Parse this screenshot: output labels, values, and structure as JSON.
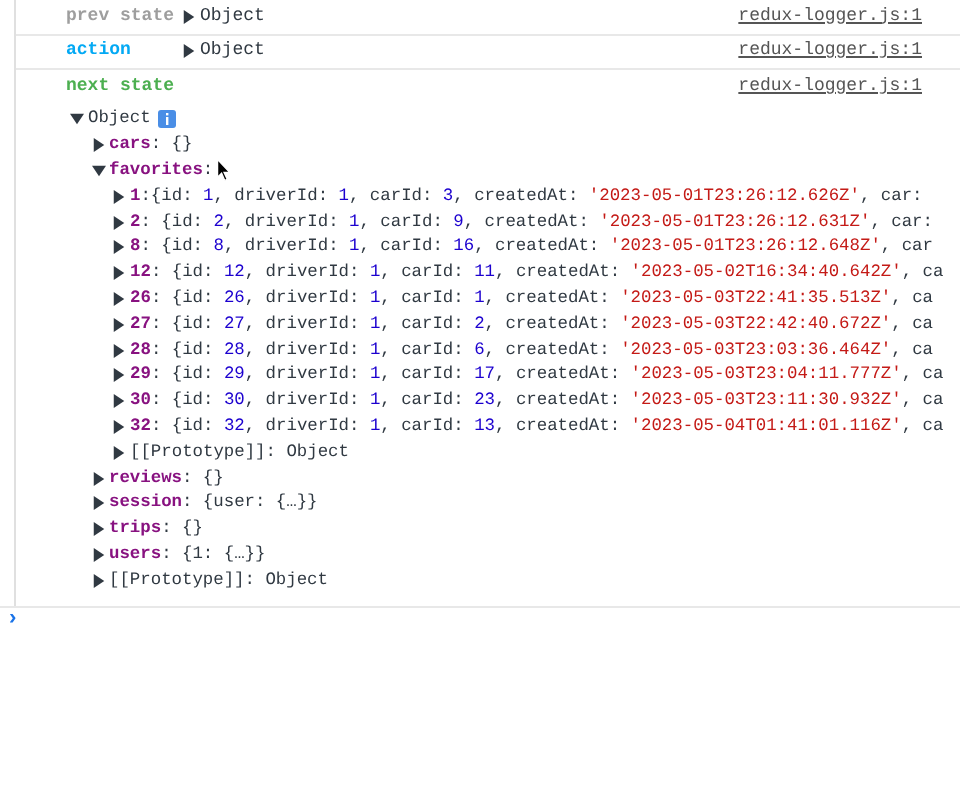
{
  "log": [
    {
      "label": "prev state",
      "kind": "prev",
      "value": "Object",
      "source": "redux-logger.js:1"
    },
    {
      "label": "action",
      "kind": "action",
      "value": "Object",
      "source": "redux-logger.js:1"
    },
    {
      "label": "next state",
      "kind": "next",
      "source": "redux-logger.js:1"
    }
  ],
  "tree": {
    "key": "Object",
    "info_badge": true,
    "expanded": true,
    "children": [
      {
        "key": "cars",
        "kind": "prop",
        "expanded": false,
        "preview": [
          {
            "text": ": {}",
            "kind": "plain"
          }
        ]
      },
      {
        "key": "favorites",
        "kind": "prop",
        "expanded": true,
        "preview": [
          {
            "text": ":",
            "kind": "plain"
          }
        ],
        "children": [
          {
            "key": "1",
            "kind": "prop",
            "expanded": false,
            "preview": [
              {
                "text": ":{id: ",
                "kind": "plain"
              },
              {
                "text": "1",
                "kind": "number"
              },
              {
                "text": ", driverId: ",
                "kind": "plain"
              },
              {
                "text": "1",
                "kind": "number"
              },
              {
                "text": ", carId: ",
                "kind": "plain"
              },
              {
                "text": "3",
                "kind": "number"
              },
              {
                "text": ", createdAt: ",
                "kind": "plain"
              },
              {
                "text": "'2023-05-01T23:26:12.626Z'",
                "kind": "string"
              },
              {
                "text": ", car:",
                "kind": "plain"
              }
            ]
          },
          {
            "key": "2",
            "kind": "prop",
            "expanded": false,
            "preview": [
              {
                "text": ": {id: ",
                "kind": "plain"
              },
              {
                "text": "2",
                "kind": "number"
              },
              {
                "text": ", driverId: ",
                "kind": "plain"
              },
              {
                "text": "1",
                "kind": "number"
              },
              {
                "text": ", carId: ",
                "kind": "plain"
              },
              {
                "text": "9",
                "kind": "number"
              },
              {
                "text": ", createdAt: ",
                "kind": "plain"
              },
              {
                "text": "'2023-05-01T23:26:12.631Z'",
                "kind": "string"
              },
              {
                "text": ", car:",
                "kind": "plain"
              }
            ]
          },
          {
            "key": "8",
            "kind": "prop",
            "expanded": false,
            "preview": [
              {
                "text": ": {id: ",
                "kind": "plain"
              },
              {
                "text": "8",
                "kind": "number"
              },
              {
                "text": ", driverId: ",
                "kind": "plain"
              },
              {
                "text": "1",
                "kind": "number"
              },
              {
                "text": ", carId: ",
                "kind": "plain"
              },
              {
                "text": "16",
                "kind": "number"
              },
              {
                "text": ", createdAt: ",
                "kind": "plain"
              },
              {
                "text": "'2023-05-01T23:26:12.648Z'",
                "kind": "string"
              },
              {
                "text": ", car",
                "kind": "plain"
              }
            ]
          },
          {
            "key": "12",
            "kind": "prop",
            "expanded": false,
            "preview": [
              {
                "text": ": {id: ",
                "kind": "plain"
              },
              {
                "text": "12",
                "kind": "number"
              },
              {
                "text": ", driverId: ",
                "kind": "plain"
              },
              {
                "text": "1",
                "kind": "number"
              },
              {
                "text": ", carId: ",
                "kind": "plain"
              },
              {
                "text": "11",
                "kind": "number"
              },
              {
                "text": ", createdAt: ",
                "kind": "plain"
              },
              {
                "text": "'2023-05-02T16:34:40.642Z'",
                "kind": "string"
              },
              {
                "text": ", ca",
                "kind": "plain"
              }
            ]
          },
          {
            "key": "26",
            "kind": "prop",
            "expanded": false,
            "preview": [
              {
                "text": ": {id: ",
                "kind": "plain"
              },
              {
                "text": "26",
                "kind": "number"
              },
              {
                "text": ", driverId: ",
                "kind": "plain"
              },
              {
                "text": "1",
                "kind": "number"
              },
              {
                "text": ", carId: ",
                "kind": "plain"
              },
              {
                "text": "1",
                "kind": "number"
              },
              {
                "text": ", createdAt: ",
                "kind": "plain"
              },
              {
                "text": "'2023-05-03T22:41:35.513Z'",
                "kind": "string"
              },
              {
                "text": ", ca",
                "kind": "plain"
              }
            ]
          },
          {
            "key": "27",
            "kind": "prop",
            "expanded": false,
            "preview": [
              {
                "text": ": {id: ",
                "kind": "plain"
              },
              {
                "text": "27",
                "kind": "number"
              },
              {
                "text": ", driverId: ",
                "kind": "plain"
              },
              {
                "text": "1",
                "kind": "number"
              },
              {
                "text": ", carId: ",
                "kind": "plain"
              },
              {
                "text": "2",
                "kind": "number"
              },
              {
                "text": ", createdAt: ",
                "kind": "plain"
              },
              {
                "text": "'2023-05-03T22:42:40.672Z'",
                "kind": "string"
              },
              {
                "text": ", ca",
                "kind": "plain"
              }
            ]
          },
          {
            "key": "28",
            "kind": "prop",
            "expanded": false,
            "preview": [
              {
                "text": ": {id: ",
                "kind": "plain"
              },
              {
                "text": "28",
                "kind": "number"
              },
              {
                "text": ", driverId: ",
                "kind": "plain"
              },
              {
                "text": "1",
                "kind": "number"
              },
              {
                "text": ", carId: ",
                "kind": "plain"
              },
              {
                "text": "6",
                "kind": "number"
              },
              {
                "text": ", createdAt: ",
                "kind": "plain"
              },
              {
                "text": "'2023-05-03T23:03:36.464Z'",
                "kind": "string"
              },
              {
                "text": ", ca",
                "kind": "plain"
              }
            ]
          },
          {
            "key": "29",
            "kind": "prop",
            "expanded": false,
            "preview": [
              {
                "text": ": {id: ",
                "kind": "plain"
              },
              {
                "text": "29",
                "kind": "number"
              },
              {
                "text": ", driverId: ",
                "kind": "plain"
              },
              {
                "text": "1",
                "kind": "number"
              },
              {
                "text": ", carId: ",
                "kind": "plain"
              },
              {
                "text": "17",
                "kind": "number"
              },
              {
                "text": ", createdAt: ",
                "kind": "plain"
              },
              {
                "text": "'2023-05-03T23:04:11.777Z'",
                "kind": "string"
              },
              {
                "text": ", ca",
                "kind": "plain"
              }
            ]
          },
          {
            "key": "30",
            "kind": "prop",
            "expanded": false,
            "preview": [
              {
                "text": ": {id: ",
                "kind": "plain"
              },
              {
                "text": "30",
                "kind": "number"
              },
              {
                "text": ", driverId: ",
                "kind": "plain"
              },
              {
                "text": "1",
                "kind": "number"
              },
              {
                "text": ", carId: ",
                "kind": "plain"
              },
              {
                "text": "23",
                "kind": "number"
              },
              {
                "text": ", createdAt: ",
                "kind": "plain"
              },
              {
                "text": "'2023-05-03T23:11:30.932Z'",
                "kind": "string"
              },
              {
                "text": ", ca",
                "kind": "plain"
              }
            ]
          },
          {
            "key": "32",
            "kind": "prop",
            "expanded": false,
            "preview": [
              {
                "text": ": {id: ",
                "kind": "plain"
              },
              {
                "text": "32",
                "kind": "number"
              },
              {
                "text": ", driverId: ",
                "kind": "plain"
              },
              {
                "text": "1",
                "kind": "number"
              },
              {
                "text": ", carId: ",
                "kind": "plain"
              },
              {
                "text": "13",
                "kind": "number"
              },
              {
                "text": ", createdAt: ",
                "kind": "plain"
              },
              {
                "text": "'2023-05-04T01:41:01.116Z'",
                "kind": "string"
              },
              {
                "text": ", ca",
                "kind": "plain"
              }
            ]
          },
          {
            "key": "[[Prototype]]",
            "kind": "internal",
            "expanded": false,
            "preview": [
              {
                "text": ": Object",
                "kind": "plain"
              }
            ]
          }
        ]
      },
      {
        "key": "reviews",
        "kind": "prop",
        "expanded": false,
        "preview": [
          {
            "text": ": {}",
            "kind": "plain"
          }
        ]
      },
      {
        "key": "session",
        "kind": "prop",
        "expanded": false,
        "preview": [
          {
            "text": ": {user: {…}}",
            "kind": "plain"
          }
        ]
      },
      {
        "key": "trips",
        "kind": "prop",
        "expanded": false,
        "preview": [
          {
            "text": ": {}",
            "kind": "plain"
          }
        ]
      },
      {
        "key": "users",
        "kind": "prop",
        "expanded": false,
        "preview": [
          {
            "text": ": {1: {…}}",
            "kind": "plain"
          }
        ]
      },
      {
        "key": "[[Prototype]]",
        "kind": "internal",
        "expanded": false,
        "preview": [
          {
            "text": ": Object",
            "kind": "plain"
          }
        ]
      }
    ]
  },
  "prompt": "›"
}
